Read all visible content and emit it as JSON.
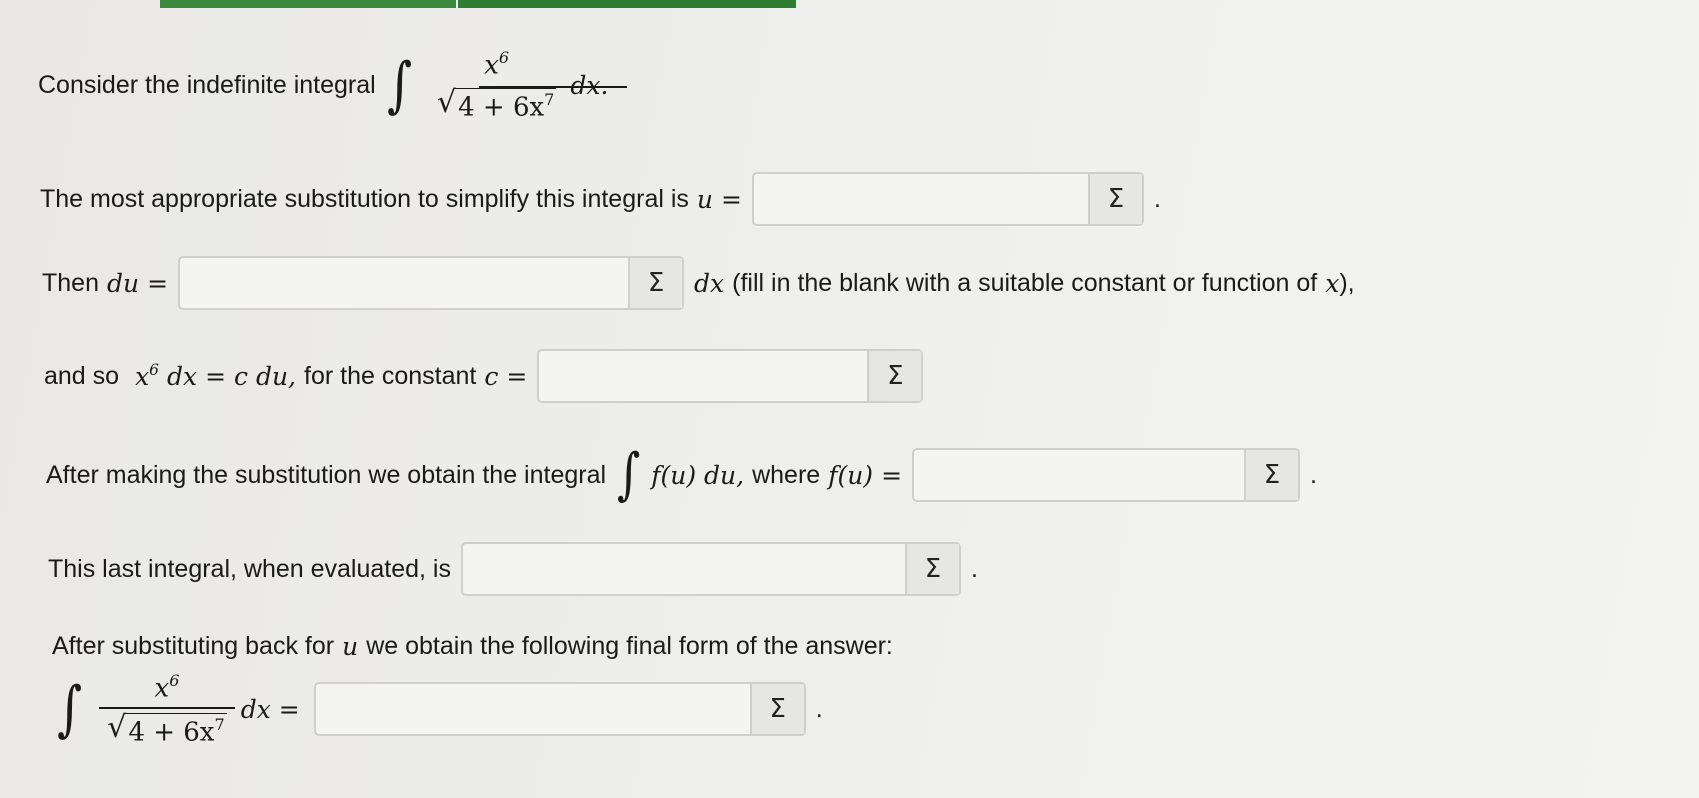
{
  "q1": {
    "text": "Consider the indefinite integral",
    "int": "∫",
    "num": "x",
    "num_exp": "6",
    "rad": "√",
    "den": "4 + 6x",
    "den_exp": "7",
    "dx": "dx."
  },
  "q2": {
    "text": "The most appropriate substitution to simplify this integral is",
    "var": "u",
    "eq": "=",
    "sigma": "Σ",
    "end": "."
  },
  "q3": {
    "text1": "Then",
    "var": "du",
    "eq": "=",
    "sigma": "Σ",
    "dx": "dx",
    "text2": "(fill in the blank with a suitable constant or function of",
    "x": "x",
    "text3": "),"
  },
  "q4": {
    "text1": "and so",
    "x": "x",
    "x_exp": "6",
    "expr": "dx = c du,",
    "text2": "for the constant",
    "c": "c",
    "eq": "=",
    "sigma": "Σ"
  },
  "q5": {
    "text1": "After making the substitution we obtain the integral",
    "int": "∫",
    "fu": "f(u) du,",
    "text2": "where",
    "fu2": "f(u)",
    "eq": "=",
    "sigma": "Σ",
    "end": "."
  },
  "q6": {
    "text": "This last integral, when evaluated, is",
    "sigma": "Σ",
    "end": "."
  },
  "q7": {
    "text1": "After substituting back for",
    "u": "u",
    "text2": "we obtain the following final form of the answer:"
  },
  "q8": {
    "int": "∫",
    "num": "x",
    "num_exp": "6",
    "rad": "√",
    "den": "4 + 6x",
    "den_exp": "7",
    "dx": "dx =",
    "sigma": "Σ",
    "end": "."
  }
}
